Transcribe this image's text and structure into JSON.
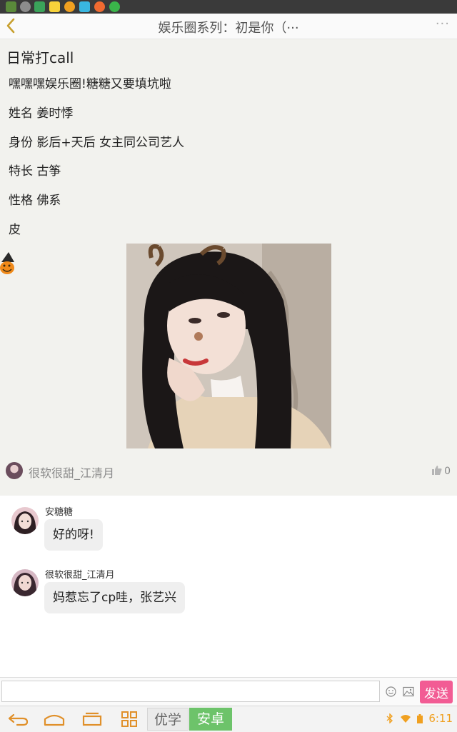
{
  "header": {
    "title": "娱乐圈系列：初是你（···",
    "more": "···"
  },
  "post": {
    "title": "日常打call",
    "lines": [
      "嘿嘿嘿娱乐圈!糖糖又要填坑啦",
      "姓名 姜时悸",
      "身份 影后+天后 女主同公司艺人",
      "特长 古筝",
      "性格 佛系",
      "皮"
    ],
    "author": "很软很甜_江清月",
    "likes": "0"
  },
  "comments": [
    {
      "name": "安糖糖",
      "text": "好的呀!"
    },
    {
      "name": "很软很甜_江清月",
      "text": "妈惹忘了cp哇，张艺兴"
    }
  ],
  "input": {
    "value": "",
    "placeholder": "",
    "send_label": "发送"
  },
  "navbar": {
    "tab_left": "优学",
    "tab_right": "安卓",
    "time": "6:11"
  },
  "colors": {
    "accent_orange": "#f0a020",
    "send_pink": "#f25c94",
    "tab_green": "#6dc36a",
    "post_bg": "#f2f2ee"
  },
  "icons": {
    "back": "chevron-left-icon",
    "emoji": "smiley-icon",
    "image": "image-icon",
    "like": "thumbs-up-icon",
    "nav": [
      "back-arrow-icon",
      "home-icon",
      "recent-apps-icon",
      "apps-grid-icon"
    ]
  }
}
